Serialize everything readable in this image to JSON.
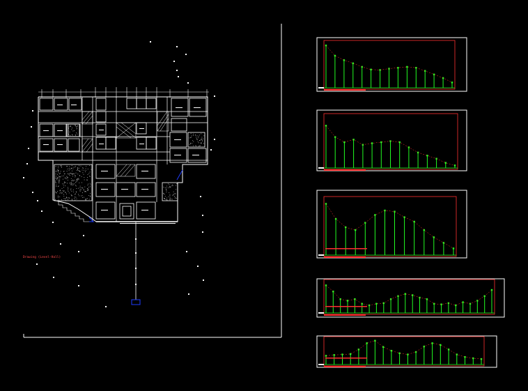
{
  "drawing": {
    "background": "#000000",
    "plan_label": "Drawing  (Level-Hall)",
    "colors": {
      "frame": "#ffffff",
      "wall": "#ffffff",
      "accent_red": "#ff3030",
      "accent_green": "#22ff22",
      "accent_blue": "#1e3cff",
      "hatch": "#cfcfcf"
    }
  },
  "profiles": [
    {
      "id": "profile-1",
      "heights": [
        0.95,
        0.72,
        0.62,
        0.55,
        0.47,
        0.41,
        0.4,
        0.43,
        0.45,
        0.47,
        0.45,
        0.38,
        0.3,
        0.22,
        0.12
      ]
    },
    {
      "id": "profile-2",
      "heights": [
        0.82,
        0.6,
        0.5,
        0.55,
        0.45,
        0.48,
        0.5,
        0.52,
        0.5,
        0.4,
        0.3,
        0.24,
        0.18,
        0.1,
        0.05
      ]
    },
    {
      "id": "profile-3",
      "heights": [
        0.92,
        0.65,
        0.5,
        0.45,
        0.58,
        0.72,
        0.8,
        0.78,
        0.68,
        0.6,
        0.45,
        0.32,
        0.22,
        0.12
      ]
    },
    {
      "id": "profile-4",
      "heights": [
        0.9,
        0.7,
        0.45,
        0.4,
        0.45,
        0.3,
        0.25,
        0.3,
        0.32,
        0.45,
        0.55,
        0.62,
        0.58,
        0.5,
        0.45,
        0.3,
        0.28,
        0.32,
        0.25,
        0.35,
        0.3,
        0.4,
        0.55,
        0.75
      ]
    },
    {
      "id": "profile-5",
      "heights": [
        0.35,
        0.38,
        0.4,
        0.42,
        0.6,
        0.85,
        0.95,
        0.7,
        0.55,
        0.45,
        0.4,
        0.5,
        0.72,
        0.85,
        0.78,
        0.6,
        0.4,
        0.3,
        0.25,
        0.22
      ]
    }
  ]
}
